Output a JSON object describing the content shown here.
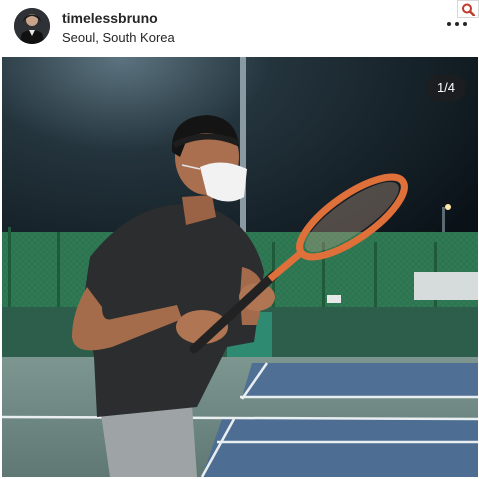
{
  "post": {
    "username": "timelessbruno",
    "location": "Seoul, South Korea"
  },
  "carousel": {
    "counter": "1/4"
  },
  "icons": {
    "more": "more-options-icon",
    "search": "search-icon",
    "avatar": "profile-avatar"
  },
  "colors": {
    "search_accent": "#c0392b",
    "racket": "#e0703a"
  }
}
